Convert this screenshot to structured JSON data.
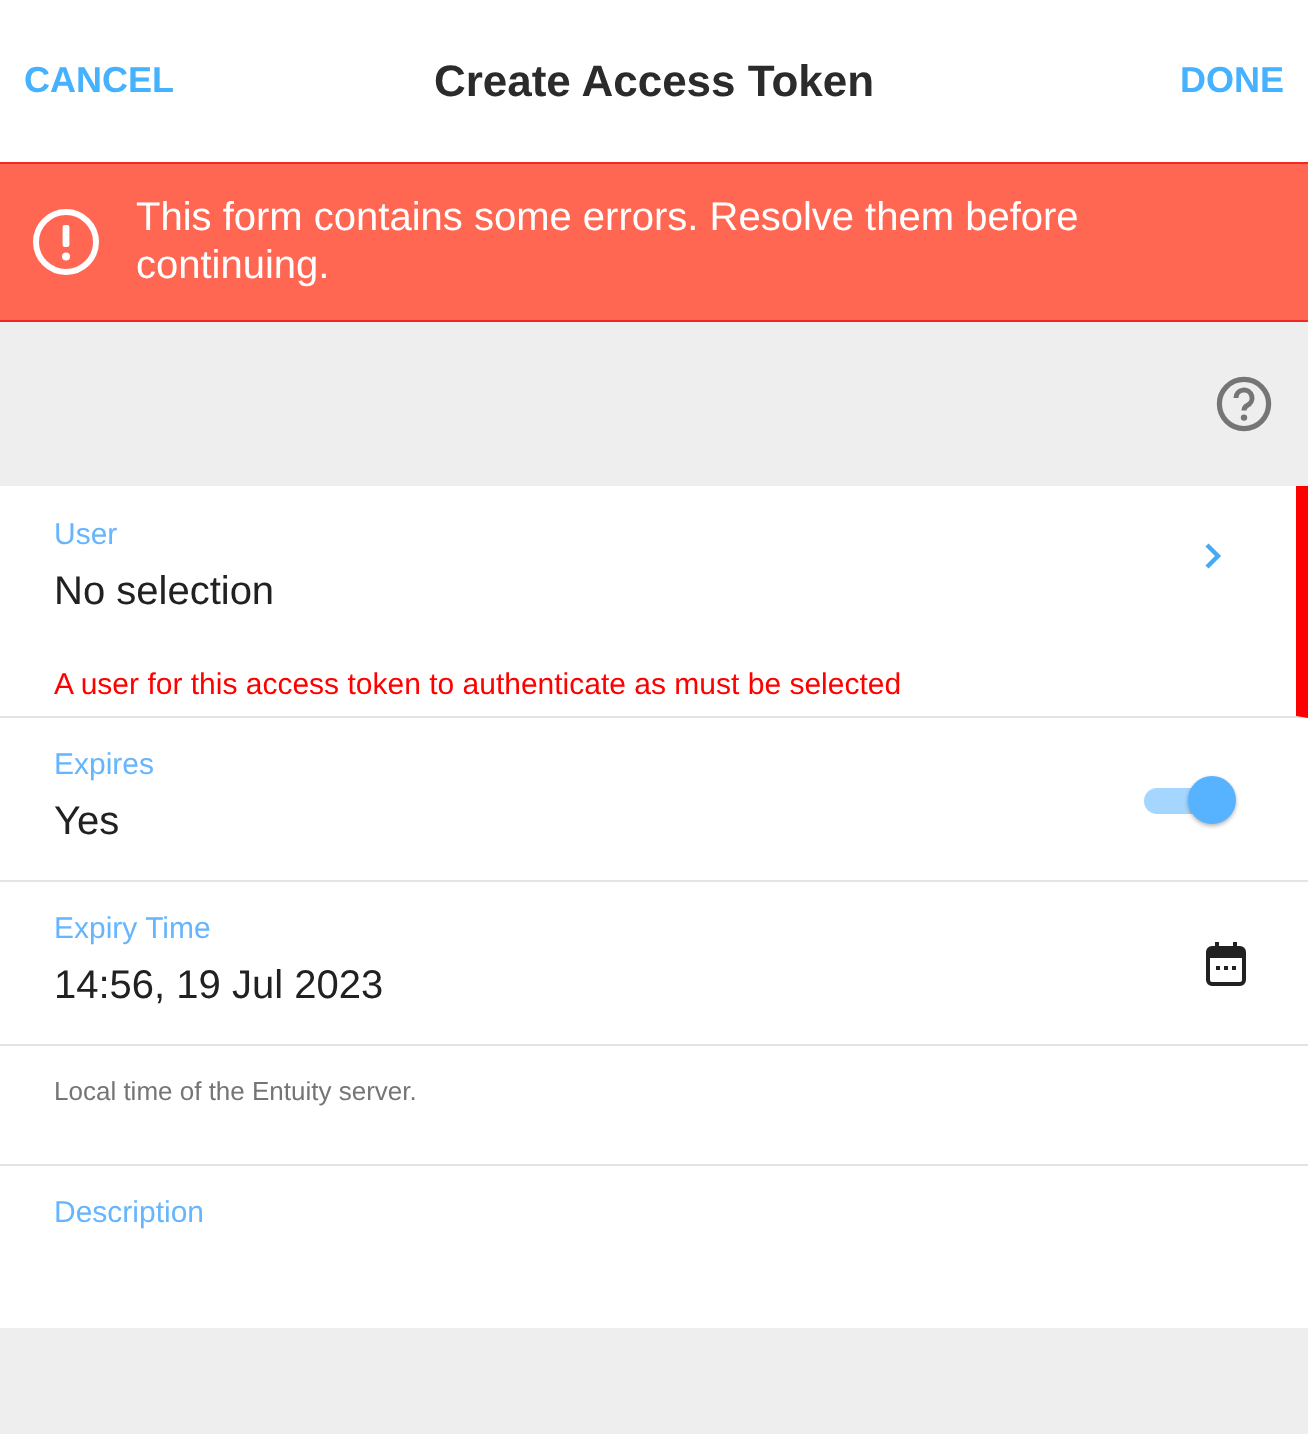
{
  "header": {
    "cancel": "CANCEL",
    "title": "Create Access Token",
    "done": "DONE"
  },
  "error_banner": {
    "message": "This form contains some errors. Resolve them before continuing."
  },
  "fields": [
    {
      "kind": "picker",
      "label": "User",
      "value": "No selection",
      "error": "A user for this access token to authenticate as must be selected"
    },
    {
      "kind": "toggle",
      "label": "Expires",
      "value": "Yes",
      "on": true
    },
    {
      "kind": "datetime",
      "label": "Expiry Time",
      "value": "14:56, 19 Jul 2023"
    },
    {
      "kind": "hint",
      "text": "Local time of the Entuity server."
    },
    {
      "kind": "text",
      "label": "Description"
    }
  ]
}
